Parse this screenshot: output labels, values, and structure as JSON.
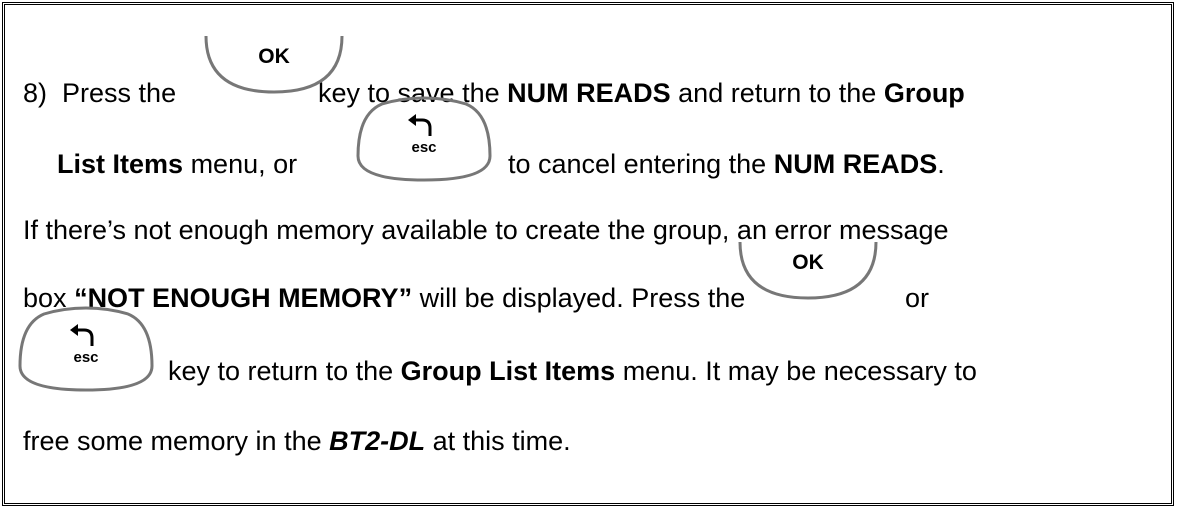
{
  "keys": {
    "ok_label": "OK",
    "esc_label": "esc"
  },
  "step8": {
    "number": "8)",
    "t1": "Press the",
    "t2": "key to save the",
    "b1": "NUM READS",
    "t3": "and return to the",
    "b2": "Group",
    "b3": "List Items",
    "t4": "menu, or",
    "t5": "to cancel entering the",
    "b4": "NUM READS",
    "t6": "."
  },
  "para": {
    "l1": "If there’s not enough memory available to create the group, an error message",
    "t1": "box",
    "b1": "“NOT ENOUGH MEMORY”",
    "t2": "will be displayed.  Press the",
    "t3": "or",
    "t4": "key to return to the",
    "b2": "Group List Items",
    "t5": "menu.  It may be necessary to",
    "t6": "free some memory in the",
    "bi1": "BT2-DL",
    "t7": "at this time."
  }
}
